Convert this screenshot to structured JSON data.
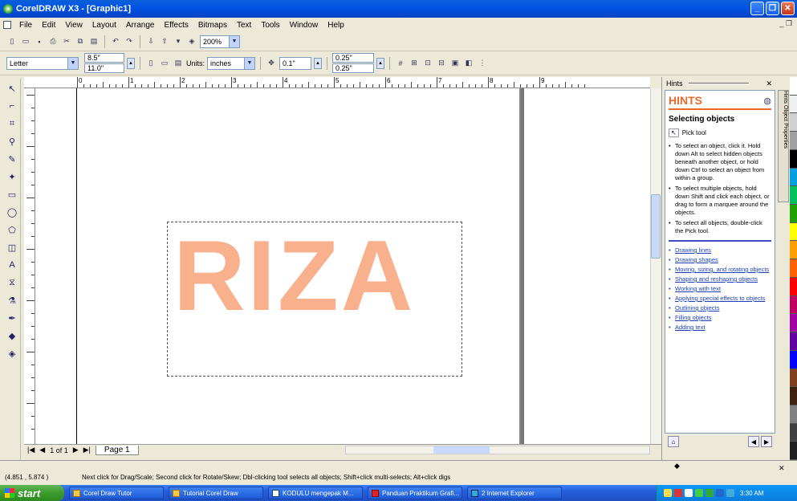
{
  "window": {
    "title": "CorelDRAW X3 - [Graphic1]"
  },
  "menu": [
    "File",
    "Edit",
    "View",
    "Layout",
    "Arrange",
    "Effects",
    "Bitmaps",
    "Text",
    "Tools",
    "Window",
    "Help"
  ],
  "toolbar1": {
    "zoom": "200%"
  },
  "toolbar2": {
    "paper": "Letter",
    "width": "8.5\"",
    "height": "11.0\"",
    "units_label": "Units:",
    "units": "inches",
    "nudge": "0.1\"",
    "dup_x": "0.25\"",
    "dup_y": "0.25\""
  },
  "ruler": {
    "h_numbers": [
      "0",
      "1",
      "2",
      "3",
      "4",
      "5",
      "6",
      "7",
      "8",
      "9"
    ],
    "unit": "inches"
  },
  "canvas": {
    "text": "RIZA",
    "text_color": "#f8b08d"
  },
  "pagebar": {
    "page_count": "1 of 1",
    "page_tab": "Page 1"
  },
  "docker": {
    "header": "Hints",
    "title": "HINTS",
    "subtitle": "Selecting objects",
    "tool": "Pick tool",
    "bullets": [
      "To select an object, click it. Hold down Alt to select hidden objects beneath another object, or hold down Ctrl to select an object from within a group.",
      "To select multiple objects, hold down Shift and click each object, or drag to form a marquee around the objects.",
      "To select all objects, double-click the Pick tool."
    ],
    "links": [
      "Drawing lines",
      "Drawing shapes",
      "Moving, sizing, and rotating objects",
      "Shaping and reshaping objects",
      "Working with text",
      "Applying special effects to objects",
      "Outlining objects",
      "Filling objects",
      "Adding text"
    ],
    "tabs": "Hints  Object Properties"
  },
  "status": {
    "coords": "(4.851 , 5.874 )",
    "hint": "Next click for Drag/Scale; Second click for Rotate/Skew; Dbl-clicking tool selects all objects; Shift+click multi-selects; Alt+click digs",
    "fill_icon": "fill-icon",
    "outline_icon": "outline-icon"
  },
  "taskbar": {
    "start": "start",
    "tasks": [
      "Corel Draw Tutor",
      "Tutorial Corel Draw",
      "KODULU mengepak M...",
      "Panduan Praktikum Grafi...",
      "2 Internet Explorer"
    ],
    "time": "3:30 AM"
  },
  "palette": [
    "#ffffff",
    "#f0f0f0",
    "#d0d0d0",
    "#a0a0a0",
    "#000000",
    "#00a0e0",
    "#00c060",
    "#20a000",
    "#ffff00",
    "#ffa000",
    "#ff6000",
    "#ff0000",
    "#c00060",
    "#a000a0",
    "#6000a0",
    "#0000ff",
    "#804020",
    "#402010",
    "#808080",
    "#404040",
    "#202020"
  ]
}
